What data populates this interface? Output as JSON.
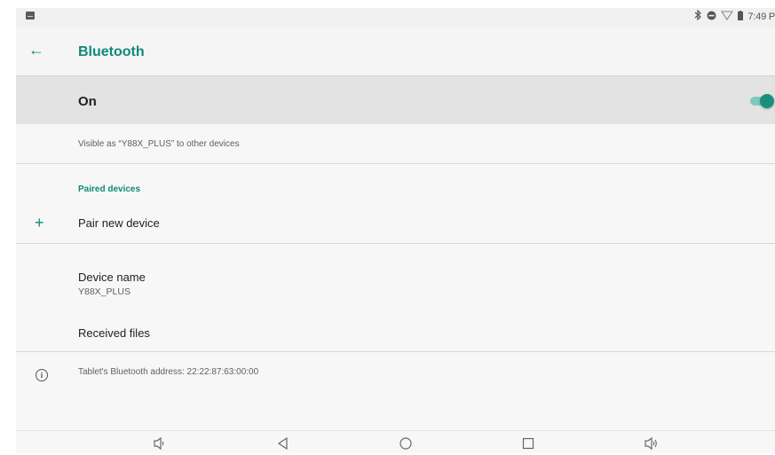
{
  "status_bar": {
    "time": "7:49 P"
  },
  "header": {
    "title": "Bluetooth"
  },
  "toggle_row": {
    "label": "On",
    "enabled": true
  },
  "visible_text": "Visible as “Y88X_PLUS” to other devices",
  "paired": {
    "section_title": "Paired devices",
    "pair_new": "Pair new device"
  },
  "device": {
    "name_label": "Device name",
    "name_value": "Y88X_PLUS",
    "received_files": "Received files"
  },
  "address_text": "Tablet's Bluetooth address: 22:22:87:63:00:00",
  "colors": {
    "accent": "#0d8a7a"
  }
}
